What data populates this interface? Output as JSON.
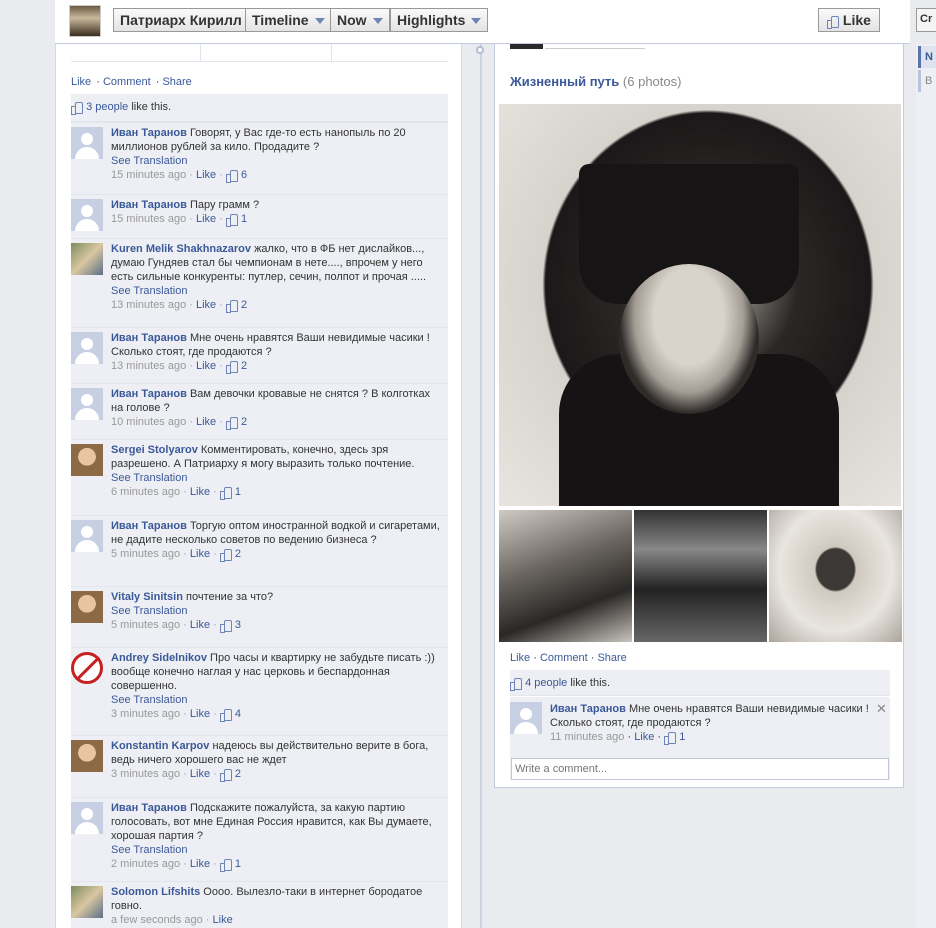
{
  "header": {
    "page_name": "Патриарх Кирилл",
    "timeline_label": "Timeline",
    "now_label": "Now",
    "highlights_label": "Highlights",
    "like_label": "Like",
    "right_button_label": "Cr"
  },
  "right_strip": {
    "item1": "N",
    "item2": "B"
  },
  "left_post": {
    "actions": {
      "like": "Like",
      "comment": "Comment",
      "share": "Share"
    },
    "likes_count": "3 people",
    "likes_suffix": " like this.",
    "comments": [
      {
        "name": "Иван Таранов",
        "text": "Говорят, у Вас где-то есть нанопыль по 20 миллионов рублей за кило. Продадите ?",
        "translation": "See Translation",
        "time": "15 minutes ago",
        "like": "Like",
        "likes": "6"
      },
      {
        "name": "Иван Таранов",
        "text": "Пару грамм ?",
        "translation": "",
        "time": "15 minutes ago",
        "like": "Like",
        "likes": "1"
      },
      {
        "name": "Kuren Melik Shakhnazarov",
        "text": "жалко, что в ФБ нет дислайков..., думаю Гундяев стал бы чемпионам в нете...., впрочем у него есть сильные конкуренты: путлер, сечин, полпот и прочая .....",
        "translation": "See Translation",
        "time": "13 minutes ago",
        "like": "Like",
        "likes": "2"
      },
      {
        "name": "Иван Таранов",
        "text": "Мне очень нравятся Ваши невидимые часики ! Сколько стоят, где продаются ?",
        "translation": "",
        "time": "13 minutes ago",
        "like": "Like",
        "likes": "2"
      },
      {
        "name": "Иван Таранов",
        "text": "Вам девочки кровавые не снятся ? В колготках на голове ?",
        "translation": "",
        "time": "10 minutes ago",
        "like": "Like",
        "likes": "2"
      },
      {
        "name": "Sergei Stolyarov",
        "text": "Комментировать, конечно, здесь зря разрешено. А Патриарху я могу выразить только почтение.",
        "translation": "See Translation",
        "time": "6 minutes ago",
        "like": "Like",
        "likes": "1"
      },
      {
        "name": "Иван Таранов",
        "text": "Торгую оптом иностранной водкой и сигаретами, не дадите несколько советов по ведению бизнеса ?",
        "translation": "",
        "time": "5 minutes ago",
        "like": "Like",
        "likes": "2"
      },
      {
        "name": "Vitaly Sinitsin",
        "text": "почтение за что?",
        "translation": "See Translation",
        "time": "5 minutes ago",
        "like": "Like",
        "likes": "3"
      },
      {
        "name": "Andrey Sidelnikov",
        "text": "Про часы и квартирку не забудьте писать :)) вообще конечно наглая у нас церковь и беспардонная совершенно.",
        "translation": "See Translation",
        "time": "3 minutes ago",
        "like": "Like",
        "likes": "4"
      },
      {
        "name": "Konstantin Karpov",
        "text": "надеюсь вы действительно верите в бога, ведь ничего хорошего вас не ждет",
        "translation": "",
        "time": "3 minutes ago",
        "like": "Like",
        "likes": "2"
      },
      {
        "name": "Иван Таранов",
        "text": "Подскажите пожалуйста, за какую партию голосовать, вот мне Единая Россия нравится, как Вы думаете, хорошая партия ?",
        "translation": "See Translation",
        "time": "2 minutes ago",
        "like": "Like",
        "likes": "1"
      },
      {
        "name": "Solomon Lifshits",
        "text": "Оооо. Вылезло-таки в интернет бородатое говно.",
        "translation": "",
        "time": "a few seconds ago",
        "like": "Like",
        "likes": ""
      }
    ]
  },
  "right_post": {
    "album_title": "Жизненный путь",
    "album_count": "(6 photos)",
    "actions": {
      "like": "Like",
      "comment": "Comment",
      "share": "Share"
    },
    "likes_count": "4 people",
    "likes_suffix": " like this.",
    "comment": {
      "name": "Иван Таранов",
      "text": "Мне очень нравятся Ваши невидимые часики ! Сколько стоят, где продаются ?",
      "time": "11 minutes ago",
      "like": "Like",
      "likes": "1"
    },
    "write_placeholder": "Write a comment...",
    "close_symbol": "✕"
  }
}
